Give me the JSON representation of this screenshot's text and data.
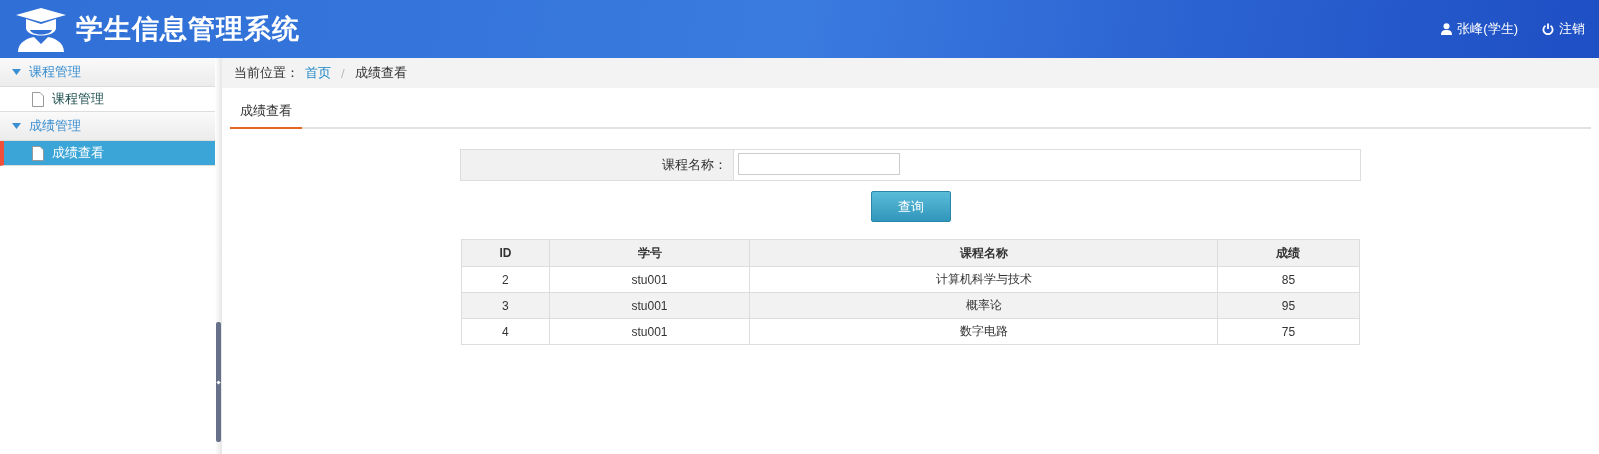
{
  "header": {
    "title": "学生信息管理系统",
    "user": "张峰(学生)",
    "logout": "注销"
  },
  "sidebar": {
    "groups": [
      {
        "label": "课程管理",
        "expanded": true,
        "items": [
          {
            "label": "课程管理",
            "selected": false
          }
        ]
      },
      {
        "label": "成绩管理",
        "expanded": true,
        "items": [
          {
            "label": "成绩查看",
            "selected": true
          }
        ]
      }
    ]
  },
  "breadcrumb": {
    "prefix": "当前位置：",
    "links": [
      "首页"
    ],
    "separator": "/",
    "current": "成绩查看"
  },
  "tabs": [
    {
      "label": "成绩查看",
      "selected": true
    }
  ],
  "search_form": {
    "label": "课程名称：",
    "button": "查询"
  },
  "table": {
    "columns": [
      "ID",
      "学号",
      "课程名称",
      "成绩"
    ],
    "rows": [
      [
        "2",
        "stu001",
        "计算机科学与技术",
        "85"
      ],
      [
        "3",
        "stu001",
        "概率论",
        "95"
      ],
      [
        "4",
        "stu001",
        "数字电路",
        "75"
      ]
    ]
  }
}
